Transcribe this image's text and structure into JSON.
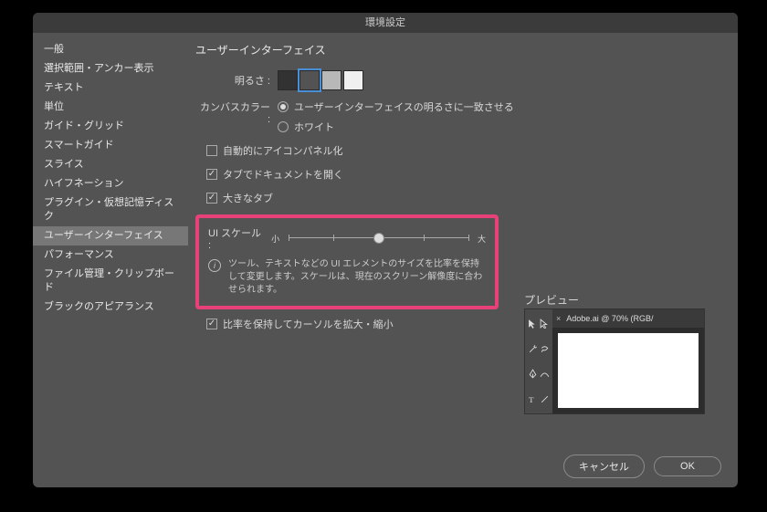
{
  "window": {
    "title": "環境設定"
  },
  "sidebar": {
    "items": [
      {
        "label": "一般"
      },
      {
        "label": "選択範囲・アンカー表示"
      },
      {
        "label": "テキスト"
      },
      {
        "label": "単位"
      },
      {
        "label": "ガイド・グリッド"
      },
      {
        "label": "スマートガイド"
      },
      {
        "label": "スライス"
      },
      {
        "label": "ハイフネーション"
      },
      {
        "label": "プラグイン・仮想記憶ディスク"
      },
      {
        "label": "ユーザーインターフェイス",
        "selected": true
      },
      {
        "label": "パフォーマンス"
      },
      {
        "label": "ファイル管理・クリップボード"
      },
      {
        "label": "ブラックのアピアランス"
      }
    ]
  },
  "main": {
    "title": "ユーザーインターフェイス",
    "brightness": {
      "label": "明るさ :",
      "swatches": [
        {
          "color": "#323232"
        },
        {
          "color": "#535353",
          "selected": true
        },
        {
          "color": "#b8b8b8"
        },
        {
          "color": "#f0f0f0"
        }
      ]
    },
    "canvas_color": {
      "label": "カンバスカラー :",
      "options": [
        {
          "label": "ユーザーインターフェイスの明るさに一致させる",
          "checked": true
        },
        {
          "label": "ホワイト",
          "checked": false
        }
      ]
    },
    "checkboxes": {
      "auto_icon": {
        "label": "自動的にアイコンパネル化",
        "checked": false
      },
      "open_tabs": {
        "label": "タブでドキュメントを開く",
        "checked": true
      },
      "large_tabs": {
        "label": "大きなタブ",
        "checked": true
      }
    },
    "ui_scale": {
      "label": "UI スケール :",
      "min_label": "小",
      "max_label": "大",
      "ticks": 5,
      "value_index": 2,
      "info": "ツール、テキストなどの UI エレメントのサイズを比率を保持して変更します。スケールは、現在のスクリーン解像度に合わせられます。"
    },
    "scale_cursor": {
      "label": "比率を保持してカーソルを拡大・縮小",
      "checked": true
    },
    "preview": {
      "label": "プレビュー",
      "tab_text": "Adobe.ai @ 70% (RGB/"
    }
  },
  "footer": {
    "cancel": "キャンセル",
    "ok": "OK"
  }
}
